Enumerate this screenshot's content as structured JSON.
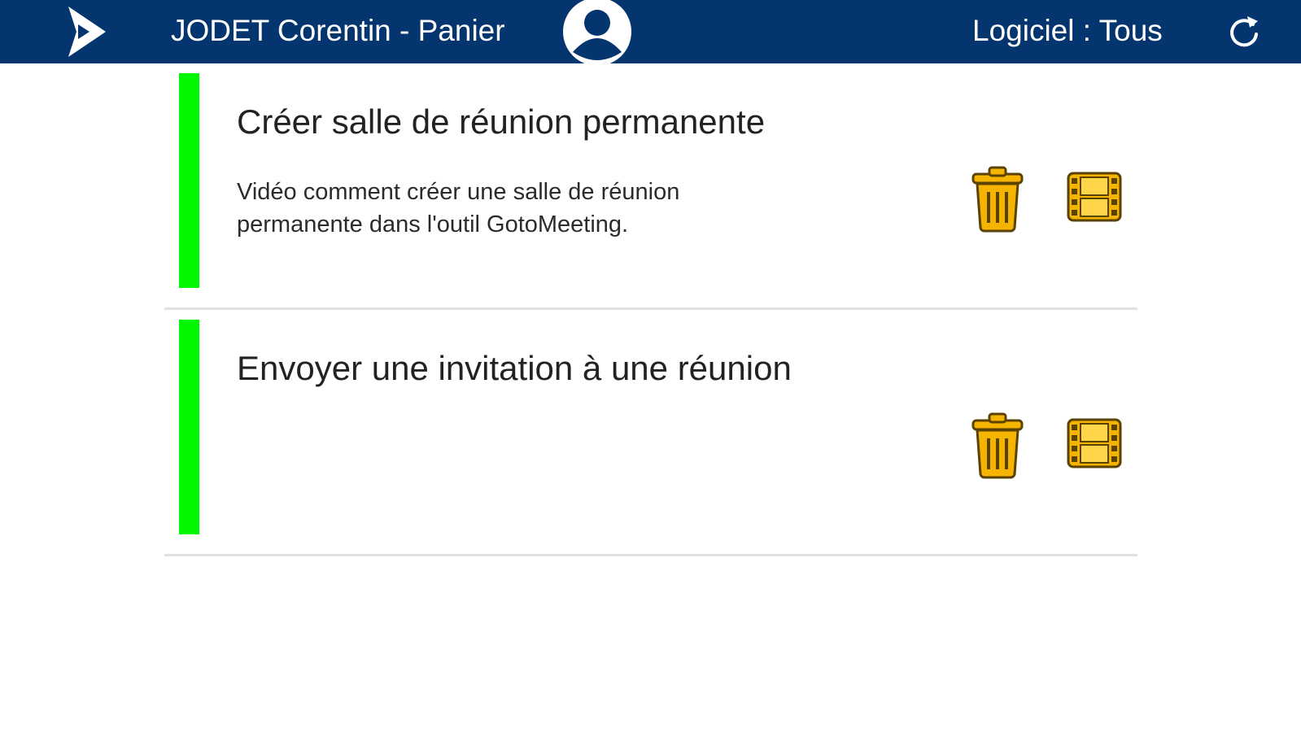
{
  "header": {
    "title": "JODET Corentin - Panier",
    "software_filter": "Logiciel : Tous",
    "icons": {
      "logo": "play-logo-icon",
      "user": "user-circle-icon",
      "refresh": "refresh-icon"
    }
  },
  "colors": {
    "header_bg": "#04356e",
    "status_green": "#00f700",
    "icon_gold": "#f5b400",
    "icon_outline": "#5a4200"
  },
  "items": [
    {
      "title": "Créer salle de réunion permanente",
      "description": "Vidéo comment créer une salle de réunion permanente dans l'outil GotoMeeting.",
      "actions": [
        "trash-icon",
        "film-icon"
      ]
    },
    {
      "title": "Envoyer une invitation à une réunion",
      "description": "",
      "actions": [
        "trash-icon",
        "film-icon"
      ]
    }
  ]
}
